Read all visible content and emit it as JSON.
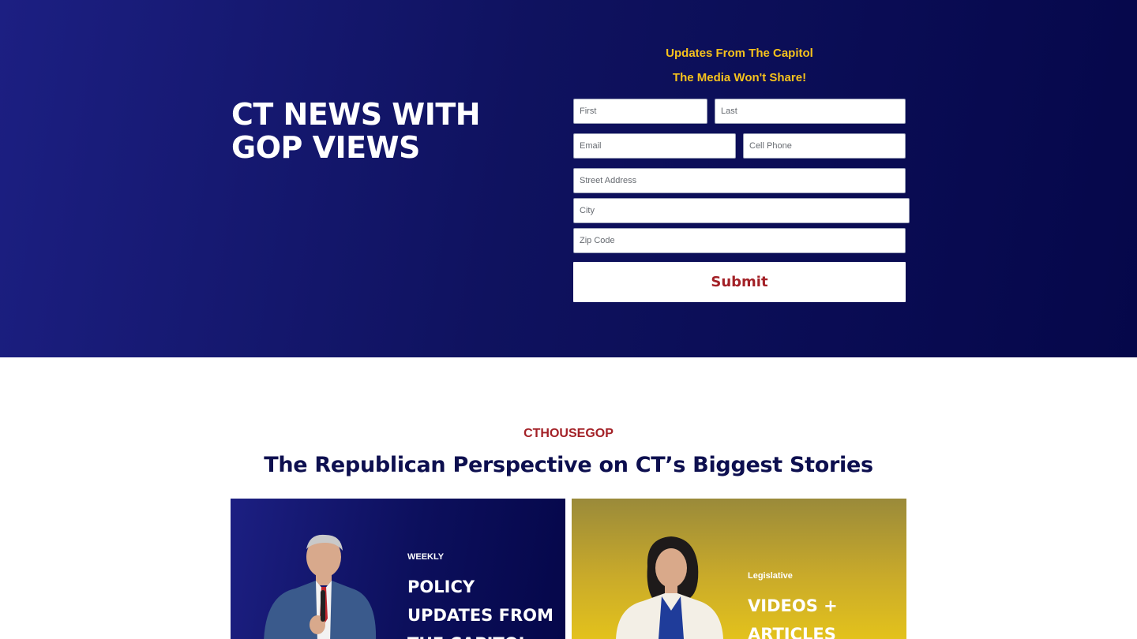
{
  "hero": {
    "title": "CT NEWS WITH GOP VIEWS"
  },
  "signup_form": {
    "heading_line1": "Updates From The Capitol",
    "heading_line2": "The Media Won't Share!",
    "fields": {
      "first": "First",
      "last": "Last",
      "email": "Email",
      "cell_phone": "Cell Phone",
      "street_address": "Street Address",
      "city": "City",
      "zip_code": "Zip Code"
    },
    "submit_label": "Submit"
  },
  "stories_section": {
    "eyebrow": "CTHOUSEGOP",
    "title": "The Republican Perspective on CT’s Biggest Stories",
    "cards": [
      {
        "eyebrow": "WEEKLY",
        "title": "POLICY UPDATES FROM THE CAPITOL"
      },
      {
        "eyebrow": "Legislative",
        "title": "VIDEOS + ARTICLES"
      }
    ]
  },
  "colors": {
    "hero_bg": "#13166c",
    "accent_gold": "#f6c21c",
    "accent_red": "#a32127",
    "navy_text": "#0d0f4f"
  }
}
